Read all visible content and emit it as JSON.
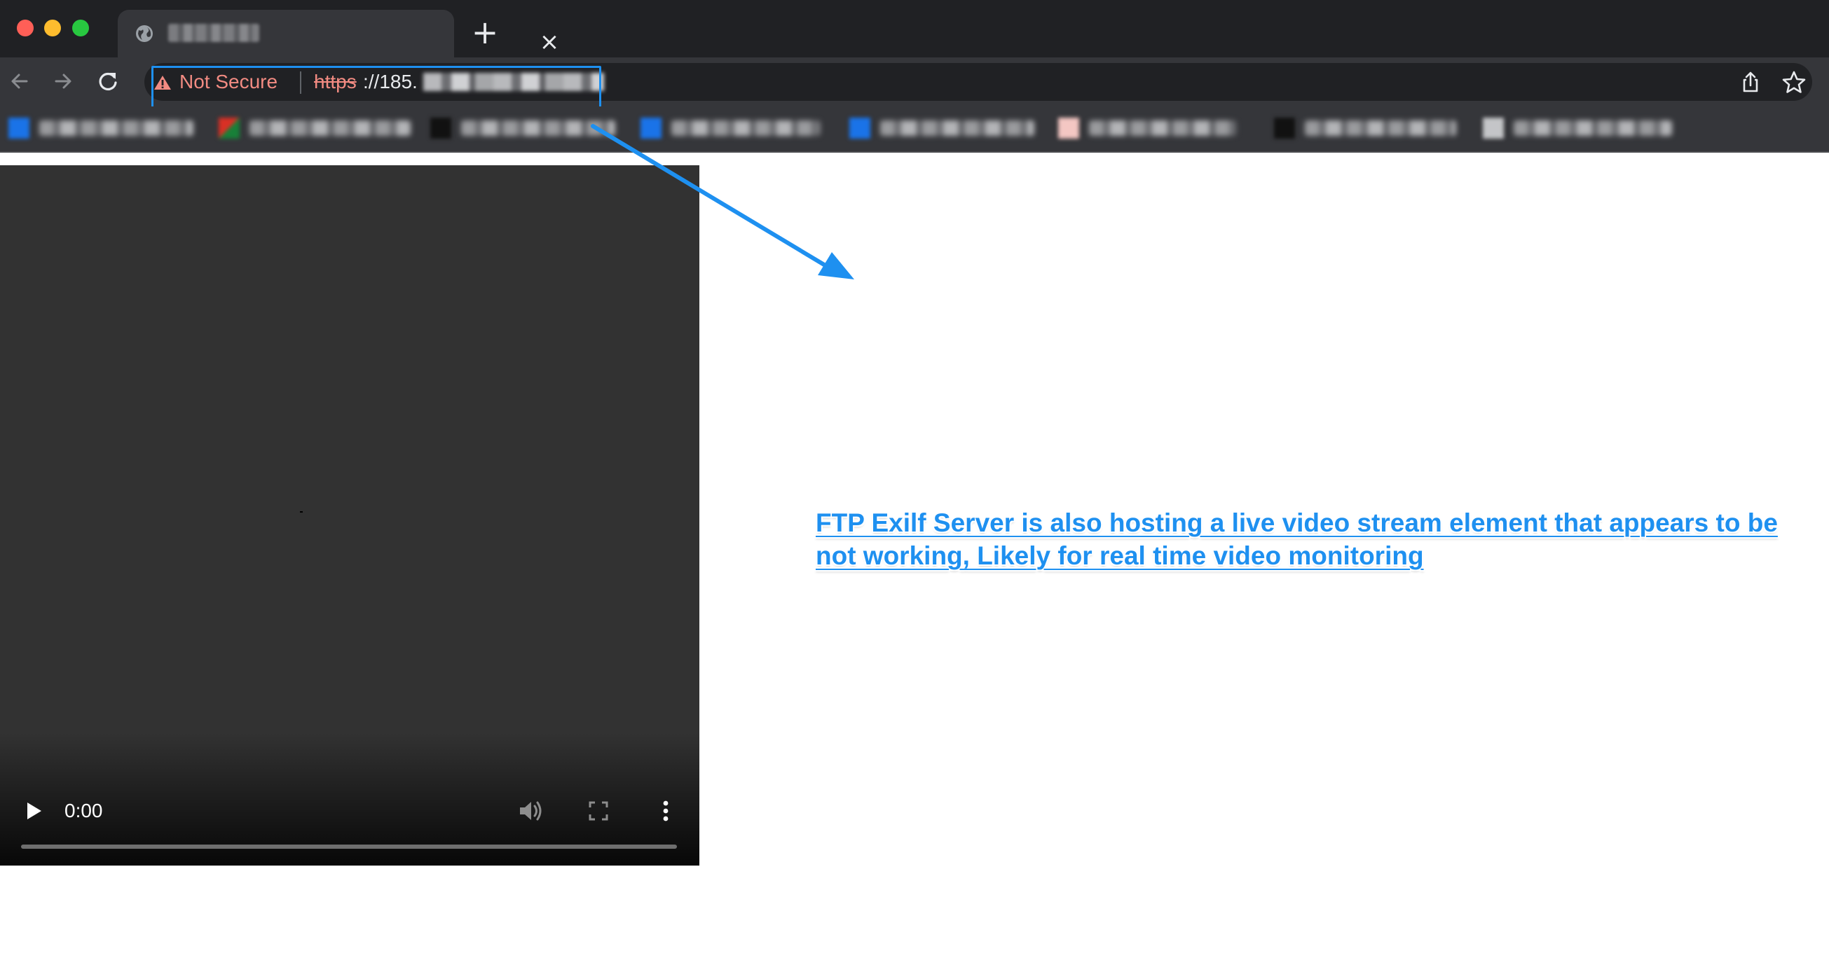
{
  "browser": {
    "address_bar": {
      "security_label": "Not Secure",
      "url_scheme": "https",
      "url_visible": "://185."
    }
  },
  "video_player": {
    "time": "0:00",
    "progress": 0
  },
  "annotation": {
    "text": "FTP Exilf Server is also hosting a live video stream element that appears to be not working, Likely for real time video monitoring"
  },
  "colors": {
    "annotation": "#1e90f0",
    "not_secure": "#f28b82",
    "chrome_dark": "#202124",
    "video_bg": "#323232"
  },
  "icons": [
    "globe-icon",
    "close-icon",
    "new-tab-icon",
    "back-arrow-icon",
    "forward-arrow-icon",
    "reload-icon",
    "warning-icon",
    "share-icon",
    "star-icon",
    "play-icon",
    "volume-icon",
    "fullscreen-icon",
    "more-vertical-icon"
  ]
}
